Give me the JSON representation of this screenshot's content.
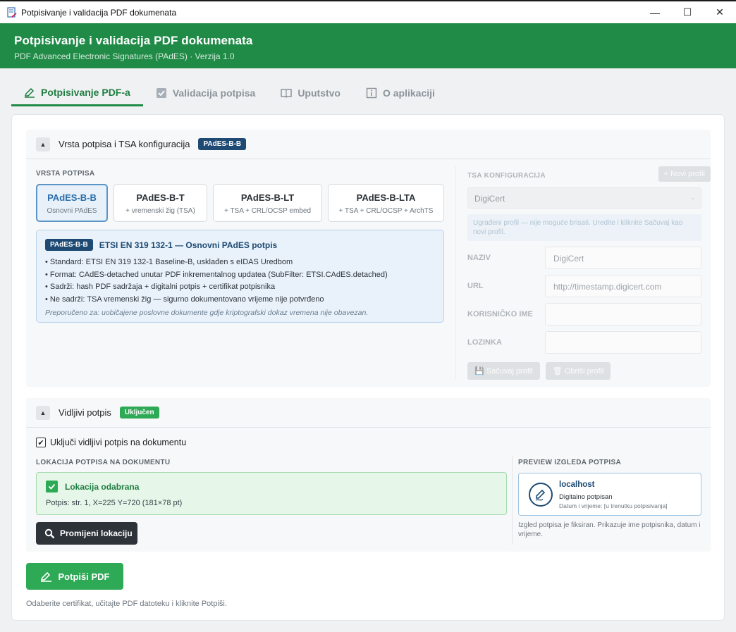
{
  "window": {
    "title": "Potpisivanje i validacija PDF dokumenata",
    "minimize": "—",
    "maximize": "☐",
    "close": "✕"
  },
  "header": {
    "title": "Potpisivanje i validacija PDF dokumenata",
    "subtitle": "PDF Advanced Electronic Signatures (PAdES) · Verzija 1.0"
  },
  "tabs": [
    {
      "label": "Potpisivanje PDF-a",
      "icon": "sign-icon",
      "active": true
    },
    {
      "label": "Validacija potpisa",
      "icon": "checkbox-icon",
      "active": false
    },
    {
      "label": "Uputstvo",
      "icon": "book-icon",
      "active": false
    },
    {
      "label": "O aplikaciji",
      "icon": "info-icon",
      "active": false
    }
  ],
  "signature_section": {
    "title": "Vrsta potpisa i TSA konfiguracija",
    "badge": "PAdES-B-B",
    "collapse_glyph": "▲",
    "type_label": "VRSTA POTPISA",
    "types": [
      {
        "name": "PAdES-B-B",
        "sub": "Osnovni PAdES"
      },
      {
        "name": "PAdES-B-T",
        "sub": "+ vremenski žig (TSA)"
      },
      {
        "name": "PAdES-B-LT",
        "sub": "+ TSA + CRL/OCSP embed"
      },
      {
        "name": "PAdES-B-LTA",
        "sub": "+ TSA + CRL/OCSP + ArchTS"
      }
    ],
    "selected_type": "PAdES-B-B",
    "info": {
      "badge": "PAdES-B-B",
      "title": "ETSI EN 319 132-1 — Osnovni PAdES potpis",
      "lines": [
        "• Standard: ETSI EN 319 132-1 Baseline-B, usklađen s eIDAS Uredbom",
        "• Format: CAdES-detached unutar PDF inkrementalnog updatea (SubFilter: ETSI.CAdES.detached)",
        "• Sadrži: hash PDF sadržaja + digitalni potpis + certifikat potpisnika",
        "• Ne sadrži: TSA vremenski žig — sigurno dokumentovano vrijeme nije potvrđeno"
      ],
      "recommendation": "Preporučeno za: uobičajene poslovne dokumente gdje kriptografski dokaz vremena nije obavezan."
    }
  },
  "tsa": {
    "label": "TSA KONFIGURACIJA",
    "new_profile_label": "+ Novi profil",
    "selected_profile": "DigiCert",
    "select_arrow": "⌄",
    "note": "Ugrađeni profil — nije moguće brisati. Uredite i kliknite Sačuvaj kao novi profil.",
    "fields": [
      {
        "label": "NAZIV",
        "value": "DigiCert"
      },
      {
        "label": "URL",
        "value": "http://timestamp.digicert.com"
      },
      {
        "label": "KORISNIČKO IME",
        "value": ""
      },
      {
        "label": "LOZINKA",
        "value": ""
      }
    ],
    "save_label": "💾 Sačuvaj profil",
    "delete_label": "🗑 Obriši profil"
  },
  "visible_section": {
    "title": "Vidljivi potpis",
    "badge": "Uključen",
    "collapse_glyph": "▲",
    "checkbox_label": "Uključi vidljivi potpis na dokumentu",
    "checkbox_checked": true,
    "check_glyph": "✔",
    "location_label": "LOKACIJA POTPISA NA DOKUMENTU",
    "location_title": "Lokacija odabrana",
    "location_value": "Potpis: str. 1, X=225 Y=720 (181×78 pt)",
    "change_button": "Promijeni lokaciju",
    "preview_label": "PREVIEW IZGLEDA POTPISA",
    "preview": {
      "name": "localhost",
      "status": "Digitalno potpisan",
      "datetime": "Datum i vrijeme: [u trenutku potpisivanja]"
    },
    "preview_note": "Izgled potpisa je fiksiran. Prikazuje ime potpisnika, datum i vrijeme."
  },
  "sign_button": "Potpiši PDF",
  "footnote": "Odaberite certifikat, učitajte PDF datoteku i kliknite Potpiši.",
  "colors": {
    "brand_green": "#208a47",
    "accent_navy": "#1e4a73",
    "success_green": "#2eaa56",
    "info_blue": "#e9f2fb"
  }
}
